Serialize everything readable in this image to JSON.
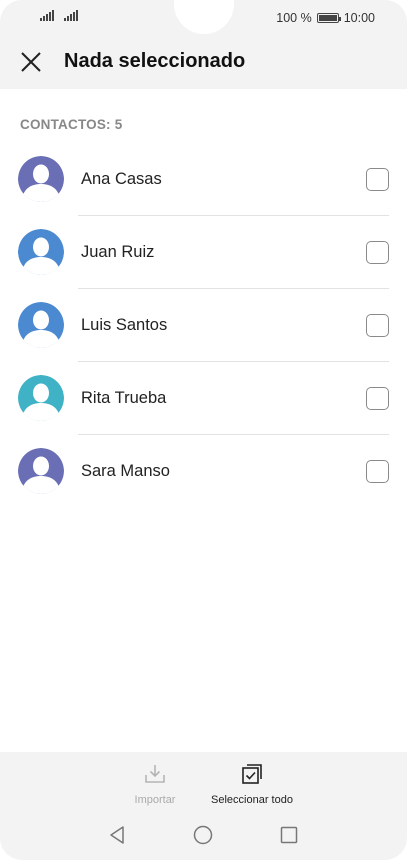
{
  "status_bar": {
    "battery_percent": "100 %",
    "time": "10:00"
  },
  "header": {
    "title": "Nada seleccionado",
    "close_icon": "close-icon"
  },
  "section": {
    "label": "CONTACTOS: 5"
  },
  "contacts": [
    {
      "name": "Ana Casas",
      "avatar_color": "#6a6fb5"
    },
    {
      "name": "Juan Ruiz",
      "avatar_color": "#4b8ad0"
    },
    {
      "name": "Luis Santos",
      "avatar_color": "#4b8ad0"
    },
    {
      "name": "Rita Trueba",
      "avatar_color": "#3fb2c6"
    },
    {
      "name": "Sara Manso",
      "avatar_color": "#6a6fb5"
    }
  ],
  "toolbar": {
    "import_label": "Importar",
    "select_all_label": "Seleccionar todo"
  },
  "colors": {
    "bar_background": "#f3f3f3",
    "disabled_text": "#aaaaaa"
  }
}
